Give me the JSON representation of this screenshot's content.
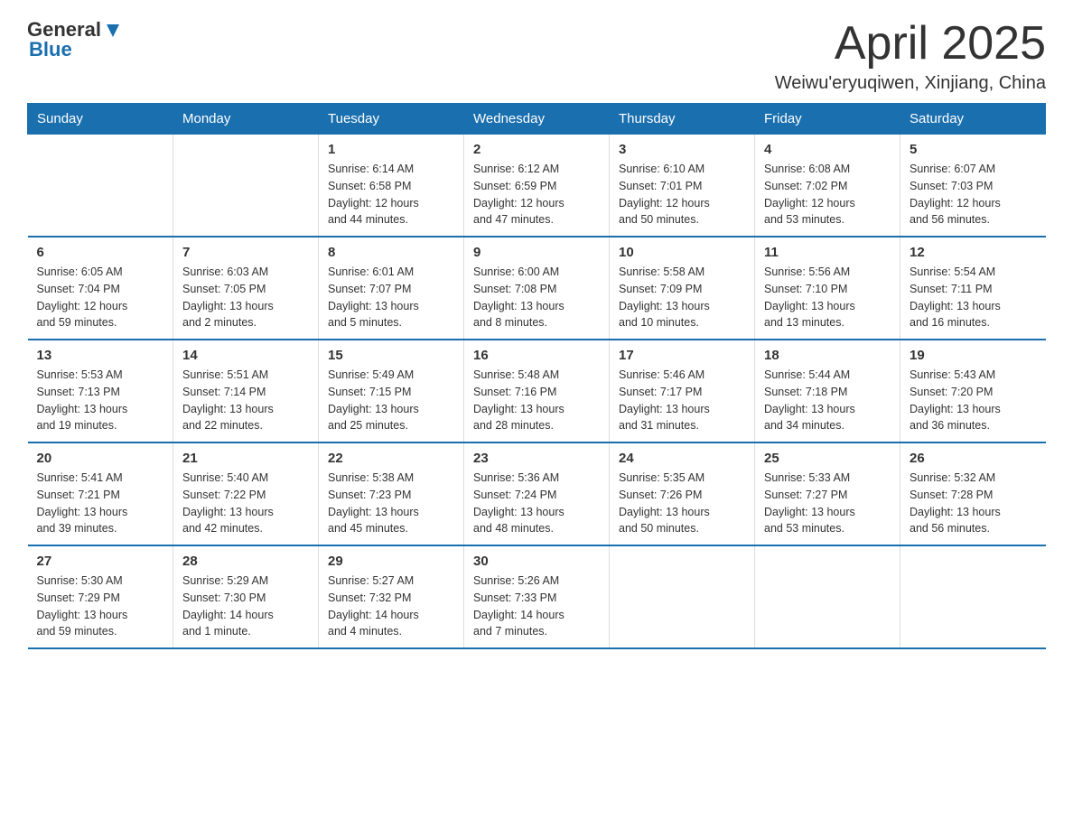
{
  "header": {
    "logo_general": "General",
    "logo_blue": "Blue",
    "month_title": "April 2025",
    "location": "Weiwu'eryuqiwen, Xinjiang, China"
  },
  "weekdays": [
    "Sunday",
    "Monday",
    "Tuesday",
    "Wednesday",
    "Thursday",
    "Friday",
    "Saturday"
  ],
  "weeks": [
    [
      {
        "day": "",
        "info": ""
      },
      {
        "day": "",
        "info": ""
      },
      {
        "day": "1",
        "info": "Sunrise: 6:14 AM\nSunset: 6:58 PM\nDaylight: 12 hours\nand 44 minutes."
      },
      {
        "day": "2",
        "info": "Sunrise: 6:12 AM\nSunset: 6:59 PM\nDaylight: 12 hours\nand 47 minutes."
      },
      {
        "day": "3",
        "info": "Sunrise: 6:10 AM\nSunset: 7:01 PM\nDaylight: 12 hours\nand 50 minutes."
      },
      {
        "day": "4",
        "info": "Sunrise: 6:08 AM\nSunset: 7:02 PM\nDaylight: 12 hours\nand 53 minutes."
      },
      {
        "day": "5",
        "info": "Sunrise: 6:07 AM\nSunset: 7:03 PM\nDaylight: 12 hours\nand 56 minutes."
      }
    ],
    [
      {
        "day": "6",
        "info": "Sunrise: 6:05 AM\nSunset: 7:04 PM\nDaylight: 12 hours\nand 59 minutes."
      },
      {
        "day": "7",
        "info": "Sunrise: 6:03 AM\nSunset: 7:05 PM\nDaylight: 13 hours\nand 2 minutes."
      },
      {
        "day": "8",
        "info": "Sunrise: 6:01 AM\nSunset: 7:07 PM\nDaylight: 13 hours\nand 5 minutes."
      },
      {
        "day": "9",
        "info": "Sunrise: 6:00 AM\nSunset: 7:08 PM\nDaylight: 13 hours\nand 8 minutes."
      },
      {
        "day": "10",
        "info": "Sunrise: 5:58 AM\nSunset: 7:09 PM\nDaylight: 13 hours\nand 10 minutes."
      },
      {
        "day": "11",
        "info": "Sunrise: 5:56 AM\nSunset: 7:10 PM\nDaylight: 13 hours\nand 13 minutes."
      },
      {
        "day": "12",
        "info": "Sunrise: 5:54 AM\nSunset: 7:11 PM\nDaylight: 13 hours\nand 16 minutes."
      }
    ],
    [
      {
        "day": "13",
        "info": "Sunrise: 5:53 AM\nSunset: 7:13 PM\nDaylight: 13 hours\nand 19 minutes."
      },
      {
        "day": "14",
        "info": "Sunrise: 5:51 AM\nSunset: 7:14 PM\nDaylight: 13 hours\nand 22 minutes."
      },
      {
        "day": "15",
        "info": "Sunrise: 5:49 AM\nSunset: 7:15 PM\nDaylight: 13 hours\nand 25 minutes."
      },
      {
        "day": "16",
        "info": "Sunrise: 5:48 AM\nSunset: 7:16 PM\nDaylight: 13 hours\nand 28 minutes."
      },
      {
        "day": "17",
        "info": "Sunrise: 5:46 AM\nSunset: 7:17 PM\nDaylight: 13 hours\nand 31 minutes."
      },
      {
        "day": "18",
        "info": "Sunrise: 5:44 AM\nSunset: 7:18 PM\nDaylight: 13 hours\nand 34 minutes."
      },
      {
        "day": "19",
        "info": "Sunrise: 5:43 AM\nSunset: 7:20 PM\nDaylight: 13 hours\nand 36 minutes."
      }
    ],
    [
      {
        "day": "20",
        "info": "Sunrise: 5:41 AM\nSunset: 7:21 PM\nDaylight: 13 hours\nand 39 minutes."
      },
      {
        "day": "21",
        "info": "Sunrise: 5:40 AM\nSunset: 7:22 PM\nDaylight: 13 hours\nand 42 minutes."
      },
      {
        "day": "22",
        "info": "Sunrise: 5:38 AM\nSunset: 7:23 PM\nDaylight: 13 hours\nand 45 minutes."
      },
      {
        "day": "23",
        "info": "Sunrise: 5:36 AM\nSunset: 7:24 PM\nDaylight: 13 hours\nand 48 minutes."
      },
      {
        "day": "24",
        "info": "Sunrise: 5:35 AM\nSunset: 7:26 PM\nDaylight: 13 hours\nand 50 minutes."
      },
      {
        "day": "25",
        "info": "Sunrise: 5:33 AM\nSunset: 7:27 PM\nDaylight: 13 hours\nand 53 minutes."
      },
      {
        "day": "26",
        "info": "Sunrise: 5:32 AM\nSunset: 7:28 PM\nDaylight: 13 hours\nand 56 minutes."
      }
    ],
    [
      {
        "day": "27",
        "info": "Sunrise: 5:30 AM\nSunset: 7:29 PM\nDaylight: 13 hours\nand 59 minutes."
      },
      {
        "day": "28",
        "info": "Sunrise: 5:29 AM\nSunset: 7:30 PM\nDaylight: 14 hours\nand 1 minute."
      },
      {
        "day": "29",
        "info": "Sunrise: 5:27 AM\nSunset: 7:32 PM\nDaylight: 14 hours\nand 4 minutes."
      },
      {
        "day": "30",
        "info": "Sunrise: 5:26 AM\nSunset: 7:33 PM\nDaylight: 14 hours\nand 7 minutes."
      },
      {
        "day": "",
        "info": ""
      },
      {
        "day": "",
        "info": ""
      },
      {
        "day": "",
        "info": ""
      }
    ]
  ]
}
